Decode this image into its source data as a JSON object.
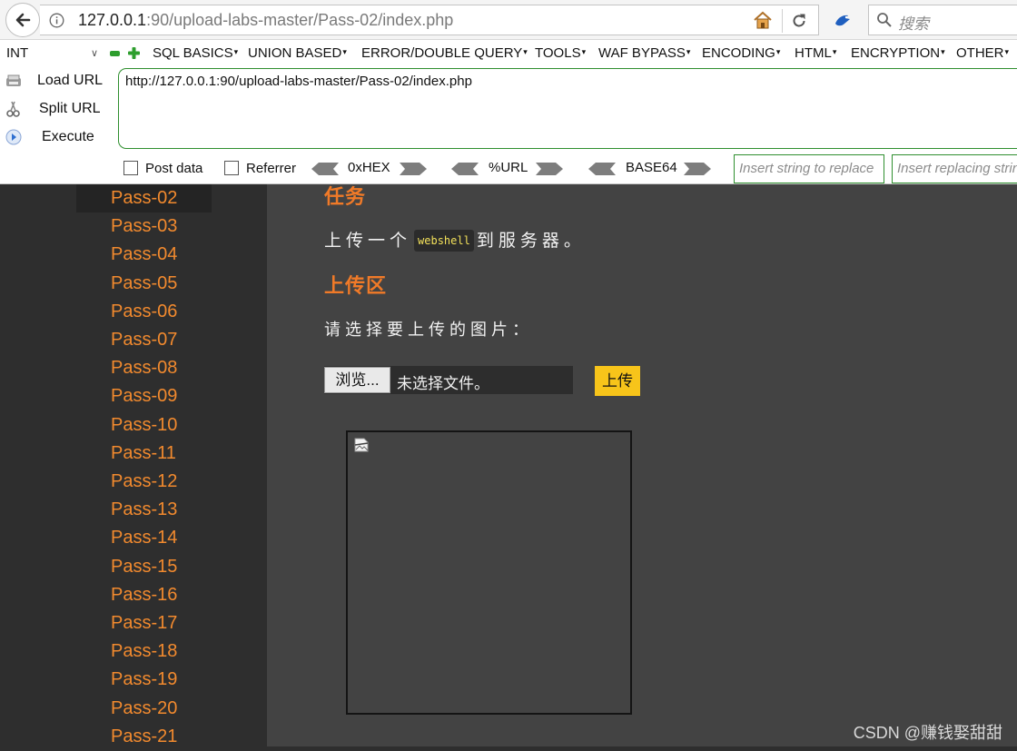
{
  "browser": {
    "url_host": "127.0.0.1",
    "url_rest": ":90/upload-labs-master/Pass-02/index.php",
    "search_placeholder": "搜索"
  },
  "hackbar": {
    "select_value": "INT",
    "menus": [
      "SQL BASICS",
      "UNION BASED",
      "ERROR/DOUBLE QUERY",
      "TOOLS",
      "WAF BYPASS",
      "ENCODING",
      "HTML",
      "ENCRYPTION",
      "OTHER"
    ],
    "load_url": "Load URL",
    "split_url": "Split URL",
    "execute": "Execute",
    "url_value": "http://127.0.0.1:90/upload-labs-master/Pass-02/index.php",
    "post_data": "Post data",
    "referrer": "Referrer",
    "hex": "0xHEX",
    "urlenc": "%URL",
    "base64": "BASE64",
    "replace_placeholder": "Insert string to replace",
    "replacing_placeholder": "Insert replacing string"
  },
  "sidebar": {
    "items": [
      "Pass-02",
      "Pass-03",
      "Pass-04",
      "Pass-05",
      "Pass-06",
      "Pass-07",
      "Pass-08",
      "Pass-09",
      "Pass-10",
      "Pass-11",
      "Pass-12",
      "Pass-13",
      "Pass-14",
      "Pass-15",
      "Pass-16",
      "Pass-17",
      "Pass-18",
      "Pass-19",
      "Pass-20",
      "Pass-21"
    ],
    "active": "Pass-02"
  },
  "main": {
    "task_heading": "任务",
    "task_prefix": "上传一个",
    "task_code": "webshell",
    "task_suffix": "到服务器。",
    "upload_heading": "上传区",
    "choose_label": "请选择要上传的图片：",
    "browse_button": "浏览...",
    "no_file": "未选择文件。",
    "upload_button": "上传"
  },
  "watermark": "CSDN @赚钱娶甜甜",
  "colors": {
    "accent": "#f07a28",
    "upload_button": "#f7c41a",
    "main_bg": "#434343",
    "sidebar_bg": "#2e2e2e"
  }
}
